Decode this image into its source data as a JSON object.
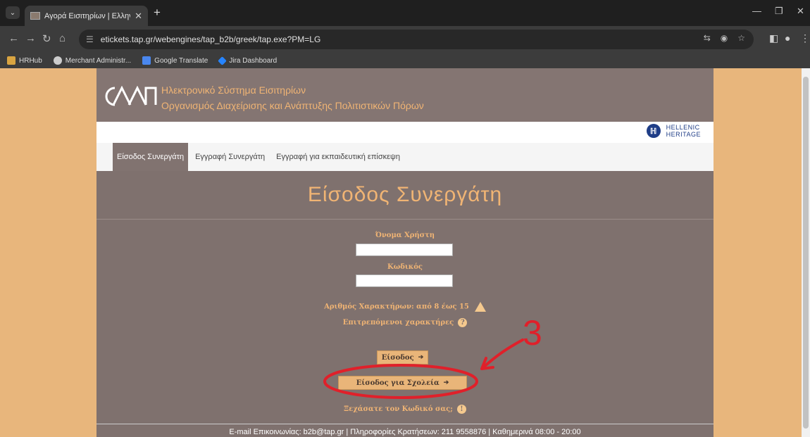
{
  "browser": {
    "tab_title": "Αγορά Εισιτηρίων | Ελληνικοί Α",
    "url": "etickets.tap.gr/webengines/tap_b2b/greek/tap.exe?PM=LG",
    "bookmarks": [
      {
        "label": "HRHub",
        "icon": "folder-icon"
      },
      {
        "label": "Merchant Administr...",
        "icon": "globe-icon"
      },
      {
        "label": "Google Translate",
        "icon": "translate-icon"
      },
      {
        "label": "Jira Dashboard",
        "icon": "jira-icon"
      }
    ]
  },
  "header": {
    "logo_text": "ΟΔΑΠ",
    "line1": "Ηλεκτρονικό Σύστημα Εισιτηρίων",
    "line2": "Οργανισμός Διαχείρισης και Ανάπτυξης Πολιτιστικών Πόρων",
    "brand_line1": "HELLENIC",
    "brand_line2": "HERITAGE"
  },
  "nav": {
    "tabs": [
      {
        "label": "Είσοδος Συνεργάτη"
      },
      {
        "label": "Εγγραφή Συνεργάτη"
      },
      {
        "label": "Εγγραφή για εκπαιδευτική επίσκεψη"
      }
    ]
  },
  "page_title": "Είσοδος Συνεργάτη",
  "form": {
    "username_label": "Όνομα Χρήστη",
    "username_value": "",
    "password_label": "Κωδικός",
    "password_value": "",
    "chars_note": "Αριθμός Χαρακτήρων: από 8 έως 15",
    "allowed_chars": "Επιτρεπόμενοι χαρακτήρες",
    "login_button": "Είσοδος",
    "school_login_button": "Είσοδος για Σχολεία",
    "forgot_password": "Ξεχάσατε τον Κωδικό σας;"
  },
  "footer": {
    "text": "E-mail Επικοινωνίας: b2b@tap.gr | Πληροφορίες Κρατήσεων: 211 9558876 | Καθημερινά  08:00 - 20:00"
  },
  "annotation": {
    "number": "3",
    "color": "#e0202a"
  }
}
